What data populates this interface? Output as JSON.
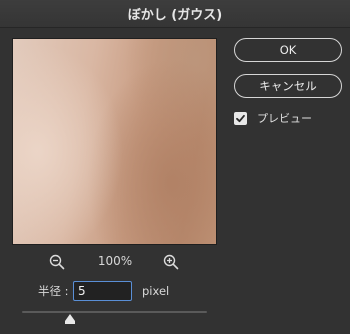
{
  "window": {
    "title": "ぼかし (ガウス)"
  },
  "preview": {
    "zoom_level": "100%",
    "zoom_out_icon": "zoom-out-icon",
    "zoom_in_icon": "zoom-in-icon"
  },
  "radius": {
    "label": "半径 :",
    "value": "5",
    "unit": "pixel",
    "slider_fraction": 0.26
  },
  "buttons": {
    "ok_label": "OK",
    "cancel_label": "キャンセル"
  },
  "preview_toggle": {
    "label": "プレビュー",
    "checked": true
  },
  "colors": {
    "background": "#323232",
    "input_focus": "#5a8fd6"
  }
}
